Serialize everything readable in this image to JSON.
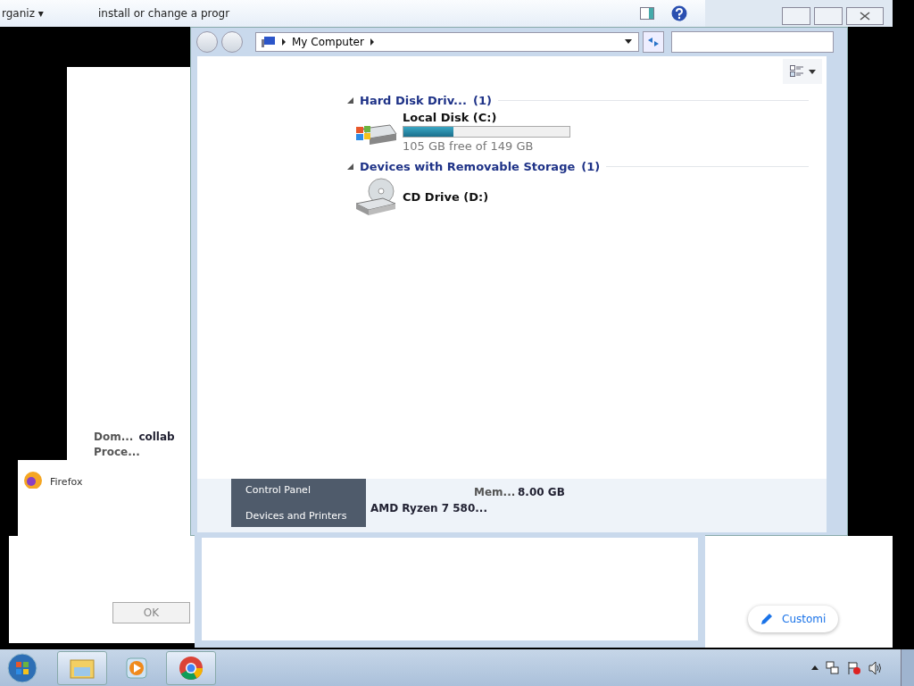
{
  "back_window": {
    "organize": "rganiz",
    "organize_caret": "▾",
    "command": "install or change a progr"
  },
  "explorer": {
    "address": "My Computer",
    "groups": [
      {
        "title": "Hard Disk Driv...",
        "count": "(1)",
        "expanded": true,
        "drives": [
          {
            "kind": "hdd",
            "name": "Local Disk (C:)",
            "level": 0.3,
            "free": "105 GB free of 149 GB"
          }
        ]
      },
      {
        "title": "Devices with Removable Storage",
        "count": "(1)",
        "expanded": true,
        "drives": [
          {
            "kind": "cd",
            "name": "CD Drive (D:)"
          }
        ]
      }
    ]
  },
  "system_info": {
    "domain_label": "Dom...",
    "domain_value": "collab",
    "processor_label": "Proce...",
    "processor_value": "AMD Ryzen 7 580...",
    "memory_label": "Mem...",
    "memory_value": "8.00 GB"
  },
  "start_menu": {
    "items": [
      "Control Panel",
      "Devices and Printers"
    ]
  },
  "firefox_label": "Firefox",
  "dialog": {
    "ok": "OK"
  },
  "customize": "Customi"
}
